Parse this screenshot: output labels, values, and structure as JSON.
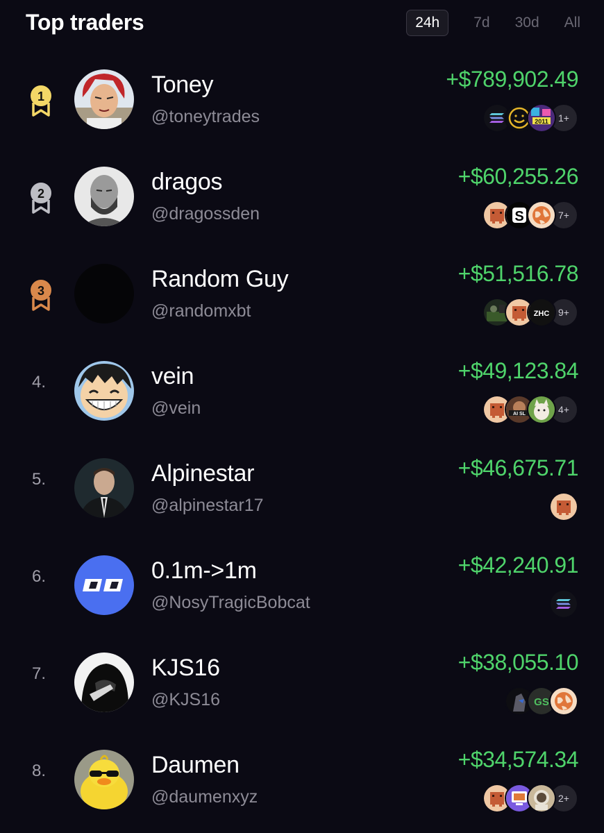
{
  "header": {
    "title": "Top traders",
    "tabs": [
      {
        "label": "24h",
        "active": true
      },
      {
        "label": "7d",
        "active": false
      },
      {
        "label": "30d",
        "active": false
      },
      {
        "label": "All",
        "active": false
      }
    ]
  },
  "colors": {
    "background": "#0b0a14",
    "profit": "#4fd46b",
    "gold": "#f3d767",
    "silver": "#bdbdc4",
    "bronze": "#d9884b"
  },
  "traders": [
    {
      "rank": "1",
      "medal": "gold",
      "name": "Toney",
      "handle": "@toneytrades",
      "pnl": "+$789,902.49",
      "avatar": "red-haired-pirate-avatar",
      "tokens": [
        "solana-token-icon",
        "smiley-token-icon",
        "pixel-2011-token-icon"
      ],
      "more": "1+"
    },
    {
      "rank": "2",
      "medal": "silver",
      "name": "dragos",
      "handle": "@dragossden",
      "pnl": "+$60,255.26",
      "avatar": "bald-bearded-man-avatar",
      "tokens": [
        "orange-pixel-token-icon",
        "s-letter-token-icon",
        "globe-token-icon"
      ],
      "more": "7+"
    },
    {
      "rank": "3",
      "medal": "bronze",
      "name": "Random Guy",
      "handle": "@randomxbt",
      "pnl": "+$51,516.78",
      "avatar": "black-avatar",
      "tokens": [
        "dark-photo-token-icon",
        "orange-pixel-token-icon",
        "zhc-token-icon"
      ],
      "more": "9+"
    },
    {
      "rank": "4.",
      "medal": "",
      "name": "vein",
      "handle": "@vein",
      "pnl": "+$49,123.84",
      "avatar": "anime-smile-avatar",
      "tokens": [
        "orange-pixel-token-icon",
        "ai-slop-token-icon",
        "cat-token-icon"
      ],
      "more": "4+"
    },
    {
      "rank": "5.",
      "medal": "",
      "name": "Alpinestar",
      "handle": "@alpinestar17",
      "pnl": "+$46,675.71",
      "avatar": "man-in-suit-avatar",
      "tokens": [
        "orange-pixel-token-icon"
      ],
      "more": ""
    },
    {
      "rank": "6.",
      "medal": "",
      "name": "0.1m->1m",
      "handle": "@NosyTragicBobcat",
      "pnl": "+$42,240.91",
      "avatar": "blue-logo-avatar",
      "tokens": [
        "solana-token-icon"
      ],
      "more": ""
    },
    {
      "rank": "7.",
      "medal": "",
      "name": "KJS16",
      "handle": "@KJS16",
      "pnl": "+$38,055.10",
      "avatar": "hooded-figure-avatar",
      "tokens": [
        "dark-figure-token-icon",
        "gs-token-icon",
        "globe-token-icon"
      ],
      "more": ""
    },
    {
      "rank": "8.",
      "medal": "",
      "name": "Daumen",
      "handle": "@daumenxyz",
      "pnl": "+$34,574.34",
      "avatar": "yellow-duck-avatar",
      "tokens": [
        "orange-pixel-token-icon",
        "purple-computer-token-icon",
        "astronaut-token-icon"
      ],
      "more": "2+"
    }
  ]
}
